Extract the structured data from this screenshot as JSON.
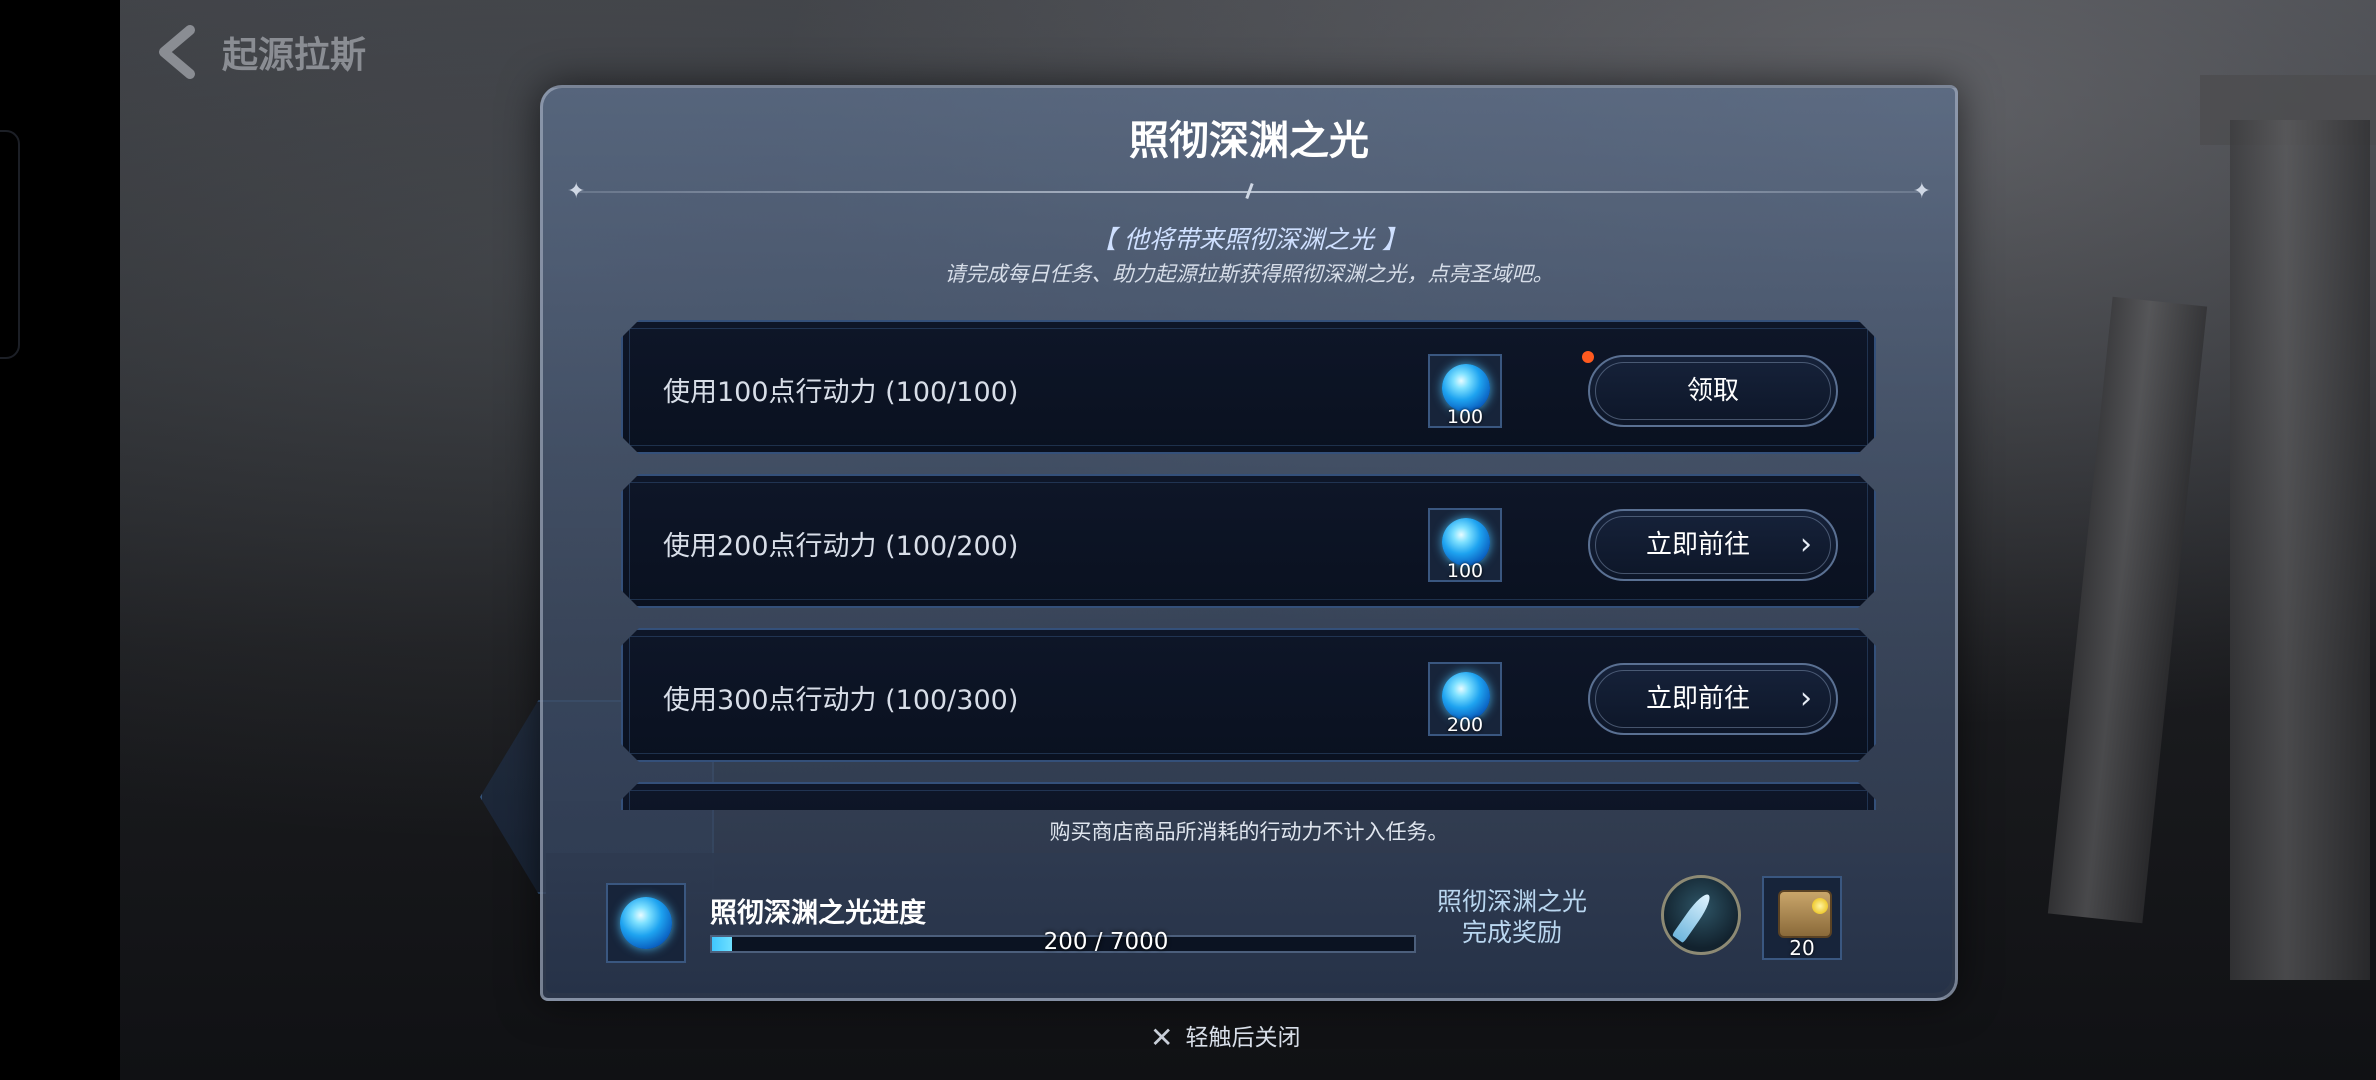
{
  "scene": {
    "title": "起源拉斯"
  },
  "modal": {
    "title": "照彻深渊之光",
    "subtitle": "【 他将带来照彻深渊之光 】",
    "description": "请完成每日任务、助力起源拉斯获得照彻深渊之光，点亮圣域吧。",
    "footnote": "购买商店商品所消耗的行动力不计入任务。"
  },
  "tasks": [
    {
      "text": "使用100点行动力 (100/100)",
      "reward_icon": "blue-orb-icon",
      "reward_qty": "100",
      "button_label": "领取",
      "button_type": "claim",
      "has_notification": true
    },
    {
      "text": "使用200点行动力 (100/200)",
      "reward_icon": "blue-orb-icon",
      "reward_qty": "100",
      "button_label": "立即前往",
      "button_type": "go",
      "has_notification": false
    },
    {
      "text": "使用300点行动力 (100/300)",
      "reward_icon": "blue-orb-icon",
      "reward_qty": "200",
      "button_label": "立即前往",
      "button_type": "go",
      "has_notification": false
    }
  ],
  "progress": {
    "label": "照彻深渊之光进度",
    "current": 200,
    "max": 7000,
    "value_text": "200 / 7000",
    "fill_color": "#3fc6ff"
  },
  "completion_reward": {
    "title": "照彻深渊之光完成奖励",
    "title_line1": "照彻深渊之光",
    "title_line2": "完成奖励",
    "emblem_icon": "feather-emblem-icon",
    "chest_icon": "treasure-chest-icon",
    "chest_qty": "20"
  },
  "close_hint": "轻触后关闭",
  "colors": {
    "accent_blue": "#3fc6ff",
    "notification": "#ff5a1f"
  }
}
